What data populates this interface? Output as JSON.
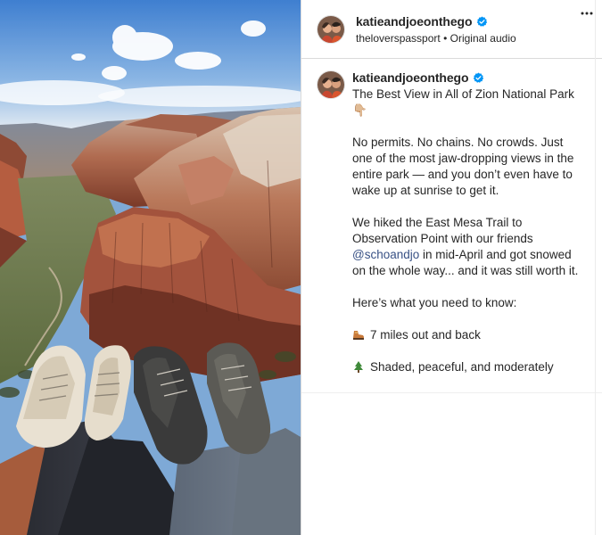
{
  "post": {
    "author": {
      "username": "katieandjoeonthego",
      "verified": true
    },
    "audio": {
      "owner": "theloverspassport",
      "separator": "•",
      "label": "Original audio"
    },
    "caption": {
      "title": "The Best View in All of Zion National Park 👇🏼",
      "paragraph1": "No permits. No chains. No crowds. Just one of the most jaw-dropping views in the entire park — and you don’t even have to wake up at sunrise to get it.",
      "paragraph2_before": "We hiked the East Mesa Trail to Observation Point with our friends ",
      "mention": "@schoandjo",
      "paragraph2_after": " in mid-April and got snowed on the whole way... and it was still worth it.",
      "paragraph3": "Here’s what you need to know:",
      "bullet1": "7 miles out and back",
      "bullet2": "Shaded, peaceful, and moderately"
    }
  },
  "icons": {
    "verified_badge": "verified-badge-icon",
    "more": "more-options-icon",
    "bullet1_icon": "hiking-boot-emoji-icon",
    "bullet2_icon": "evergreen-tree-emoji-icon"
  },
  "colors": {
    "verified": "#0095f6",
    "mention": "#385185",
    "text": "#262626",
    "divider": "#dbdbdb"
  }
}
